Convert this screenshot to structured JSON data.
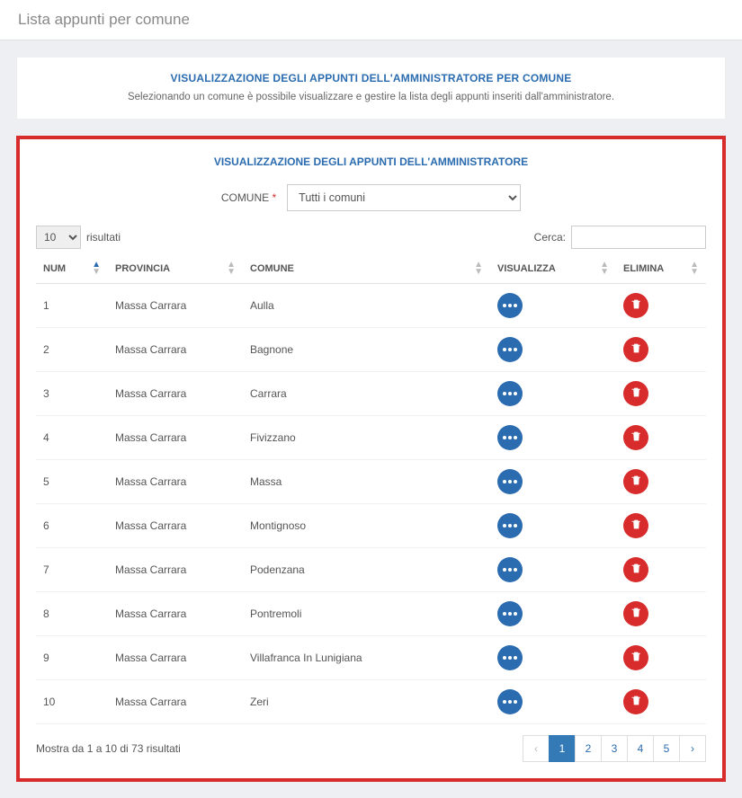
{
  "header": {
    "title": "Lista appunti per comune"
  },
  "info_card": {
    "title": "VISUALIZZAZIONE DEGLI APPUNTI DELL'AMMINISTRATORE PER COMUNE",
    "subtitle": "Selezionando un comune è possibile visualizzare e gestire la lista degli appunti inseriti dall'amministratore."
  },
  "main_card": {
    "title": "VISUALIZZAZIONE DEGLI APPUNTI DELL'AMMINISTRATORE",
    "filter_label": "COMUNE",
    "filter_required_mark": "*",
    "comune_select_value": "Tutti i comuni",
    "page_size_value": "10",
    "risultati_label": "risultati",
    "search_label": "Cerca:",
    "columns": {
      "num": "NUM",
      "provincia": "PROVINCIA",
      "comune": "COMUNE",
      "visualizza": "VISUALIZZA",
      "elimina": "ELIMINA"
    },
    "rows": [
      {
        "num": "1",
        "provincia": "Massa Carrara",
        "comune": "Aulla"
      },
      {
        "num": "2",
        "provincia": "Massa Carrara",
        "comune": "Bagnone"
      },
      {
        "num": "3",
        "provincia": "Massa Carrara",
        "comune": "Carrara"
      },
      {
        "num": "4",
        "provincia": "Massa Carrara",
        "comune": "Fivizzano"
      },
      {
        "num": "5",
        "provincia": "Massa Carrara",
        "comune": "Massa"
      },
      {
        "num": "6",
        "provincia": "Massa Carrara",
        "comune": "Montignoso"
      },
      {
        "num": "7",
        "provincia": "Massa Carrara",
        "comune": "Podenzana"
      },
      {
        "num": "8",
        "provincia": "Massa Carrara",
        "comune": "Pontremoli"
      },
      {
        "num": "9",
        "provincia": "Massa Carrara",
        "comune": "Villafranca In Lunigiana"
      },
      {
        "num": "10",
        "provincia": "Massa Carrara",
        "comune": "Zeri"
      }
    ],
    "results_info": "Mostra da 1 a 10 di 73 risultati",
    "pagination": {
      "prev": "‹",
      "pages": [
        "1",
        "2",
        "3",
        "4",
        "5"
      ],
      "next": "›",
      "active_index": 0
    }
  },
  "colors": {
    "accent_blue": "#2b6cb0",
    "danger_red": "#d82c2c",
    "primary_button": "#337ab7"
  }
}
